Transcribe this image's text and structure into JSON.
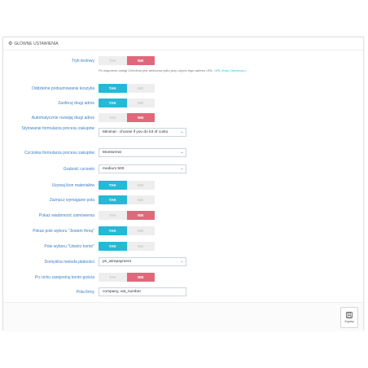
{
  "panel": {
    "title": "GŁÓWNE USTAWIENIA",
    "header_icon": "cogs-icon"
  },
  "help": {
    "text": "Po włączeniu usługi Checkout jest widoczna tylko przy użyciu tego adresu URL:",
    "link": "URL testu Checkout-u"
  },
  "rows": [
    {
      "label": "Tryb testowy",
      "type": "switch",
      "yes": "TAK",
      "no": "NIE",
      "value": "no"
    },
    {
      "label": "Oddzielne podsumowanie koszyka",
      "type": "switch",
      "yes": "TAK",
      "no": "NIE",
      "value": "yes"
    },
    {
      "label": "Zaoferuj drugi adres",
      "type": "switch",
      "yes": "TAK",
      "no": "NIE",
      "value": "yes"
    },
    {
      "label": "Automatycznie rozwijaj drugi adres",
      "type": "switch",
      "yes": "TAK",
      "no": "NIE",
      "value": "no"
    },
    {
      "label": "Stylowanie formularza procesu zakupów",
      "type": "select",
      "value": "Minimal - choose if you do lot of custo"
    },
    {
      "label": "Czcionka formularza procesu zakupów",
      "type": "select",
      "value": "Montserrat"
    },
    {
      "label": "Grubość czcionki",
      "type": "select",
      "value": "medium 500"
    },
    {
      "label": "Używaj ikon materiałów",
      "type": "switch",
      "yes": "TAK",
      "no": "NIE",
      "value": "yes"
    },
    {
      "label": "Zaznacz wymagane pola",
      "type": "switch",
      "yes": "TAK",
      "no": "NIE",
      "value": "yes"
    },
    {
      "label": "Pokaż wiadomość zamówienia",
      "type": "switch",
      "yes": "TAK",
      "no": "NIE",
      "value": "no"
    },
    {
      "label": "Pokaż pole wyboru \"Jestem firmą\"",
      "type": "switch",
      "yes": "TAK",
      "no": "NIE",
      "value": "yes"
    },
    {
      "label": "Pole wyboru \"Utwórz konto\"",
      "type": "switch",
      "yes": "TAK",
      "no": "NIE",
      "value": "yes"
    },
    {
      "label": "Domyślna metoda płatności",
      "type": "select",
      "value": "ps_wirepayment"
    },
    {
      "label": "Po cichu zarejestruj konto gościa",
      "type": "switch",
      "yes": "TAK",
      "no": "NIE",
      "value": "no"
    },
    {
      "label": "Pola firmy",
      "type": "text",
      "value": "company, vat_number"
    }
  ],
  "footer": {
    "save_label": "Zapisz",
    "save_icon": "floppy-disk-icon"
  },
  "colors": {
    "yes_active": "#25b9d7",
    "no_active": "#e0687b",
    "label": "#3b7fc4"
  }
}
